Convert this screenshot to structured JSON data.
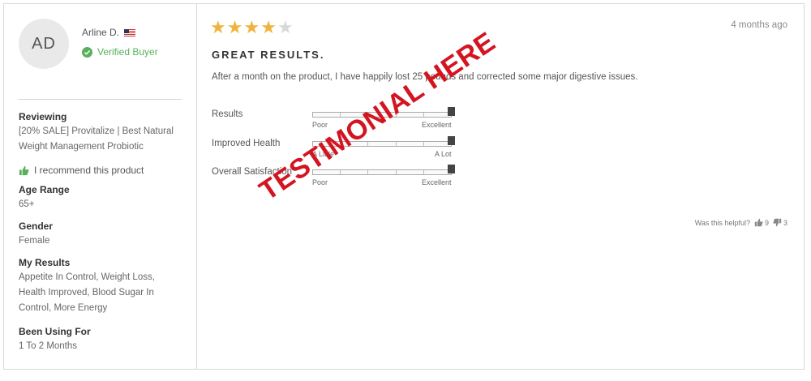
{
  "reviewer": {
    "initials": "AD",
    "name": "Arline D.",
    "verified_label": "Verified Buyer"
  },
  "sidebar": {
    "reviewing_label": "Reviewing",
    "reviewing_value": "[20% SALE] Provitalize | Best Natural Weight Management Probiotic",
    "recommend_text": "I recommend this product",
    "age_label": "Age Range",
    "age_value": "65+",
    "gender_label": "Gender",
    "gender_value": "Female",
    "results_label": "My Results",
    "results_value": "Appetite In Control, Weight Loss, Health Improved, Blood Sugar In Control, More Energy",
    "using_label": "Been Using For",
    "using_value": "1 To 2 Months"
  },
  "review": {
    "rating": 4,
    "rating_max": 5,
    "date": "4 months ago",
    "title": "GREAT RESULTS.",
    "body": "After a month on the product, I have happily lost 25 pounds and corrected some major digestive issues."
  },
  "ratings": [
    {
      "label": "Results",
      "min_label": "Poor",
      "max_label": "Excellent",
      "value": 1.0
    },
    {
      "label": "Improved Health",
      "min_label": "A Little",
      "max_label": "A Lot",
      "value": 1.0
    },
    {
      "label": "Overall Satisfaction",
      "min_label": "Poor",
      "max_label": "Excellent",
      "value": 1.0
    }
  ],
  "helpful": {
    "question": "Was this helpful?",
    "up_count": "9",
    "down_count": "3"
  },
  "watermark": "TESTIMONIAL HERE",
  "colors": {
    "star": "#f0b43c",
    "verified": "#58b15a",
    "watermark": "#d41420"
  }
}
